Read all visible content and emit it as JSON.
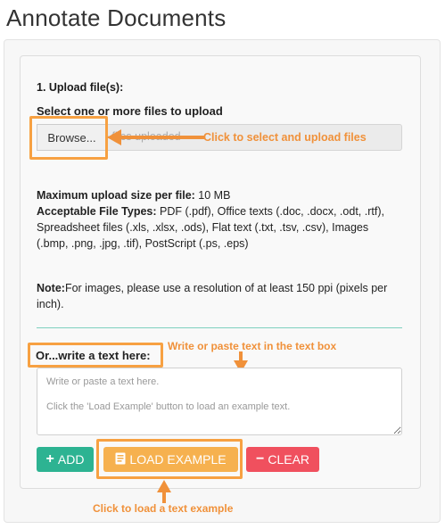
{
  "page": {
    "title": "Annotate Documents"
  },
  "upload": {
    "section_heading": "1. Upload file(s):",
    "select_label": "Select one or more files to upload",
    "browse_label": "Browse...",
    "file_status": "No files uploaded",
    "max_size_label": "Maximum upload size per file:",
    "max_size_value": " 10 MB",
    "types_label": "Acceptable File Types:",
    "types_value": " PDF (.pdf), Office texts (.doc, .docx, .odt, .rtf), Spreadsheet files (.xls, .xlsx, .ods), Flat text (.txt, .tsv, .csv), Images (.bmp, .png, .jpg, .tif), PostScript (.ps, .eps)",
    "note_label": "Note:",
    "note_value": "For images, please use a resolution of at least 150 ppi (pixels per inch)."
  },
  "text_input": {
    "label": "Or...write a text here:",
    "placeholder": "Write or paste a text here.\n\nClick the 'Load Example' button to load an example text."
  },
  "buttons": {
    "add_label": "ADD",
    "load_example_label": "LOAD EXAMPLE",
    "clear_label": "CLEAR"
  },
  "annotations": {
    "upload_hint": "Click to select and upload files",
    "write_hint": "Write or paste text in the text box",
    "load_example_hint": "Click to load a text example"
  },
  "colors": {
    "add": "#2db392",
    "load_example": "#f6b14f",
    "clear": "#f0505e",
    "callout": "#f7a142",
    "divider": "#7fd1bf"
  },
  "icons": {
    "add": "plus-icon",
    "load_example": "book-icon",
    "clear": "minus-icon"
  }
}
